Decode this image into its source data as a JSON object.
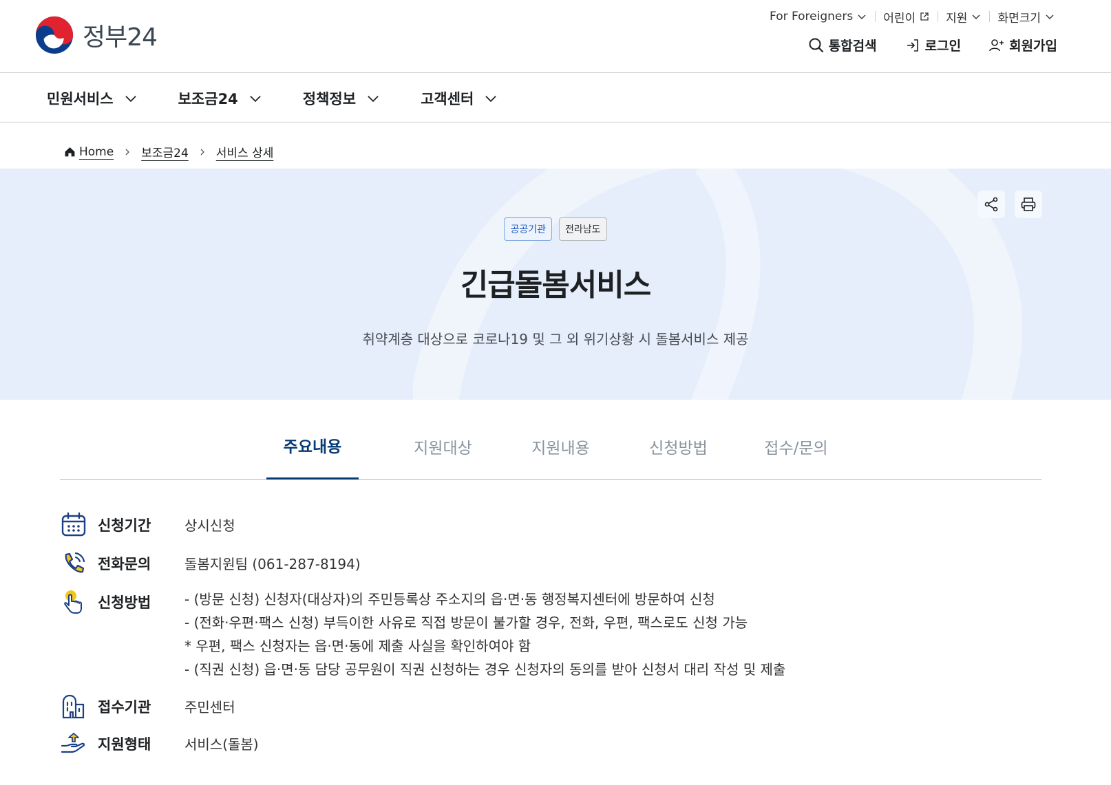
{
  "header": {
    "logo_text": "정부24",
    "util": [
      {
        "label": "For Foreigners",
        "icon": "chevron-down-icon"
      },
      {
        "label": "어린이",
        "icon": "external-link-icon"
      },
      {
        "label": "지원",
        "icon": "chevron-down-icon"
      },
      {
        "label": "화면크기",
        "icon": "chevron-down-icon"
      }
    ],
    "actions": {
      "search": "통합검색",
      "login": "로그인",
      "signup": "회원가입"
    }
  },
  "gnb": {
    "items": [
      "민원서비스",
      "보조금24",
      "정책정보",
      "고객센터"
    ]
  },
  "breadcrumb": [
    "Home",
    "보조금24",
    "서비스 상세"
  ],
  "hero": {
    "tags": [
      "공공기관",
      "전라남도"
    ],
    "title": "긴급돌봄서비스",
    "description": "취약계층 대상으로 코로나19 및 그 외 위기상황 시 돌봄서비스 제공"
  },
  "tabs": [
    "주요내용",
    "지원대상",
    "지원내용",
    "신청방법",
    "접수/문의"
  ],
  "active_tab": "주요내용",
  "details": {
    "period": {
      "label": "신청기간",
      "value": "상시신청"
    },
    "phone": {
      "label": "전화문의",
      "value": "돌봄지원팀 (061-287-8194)"
    },
    "method": {
      "label": "신청방법",
      "lines": [
        "- (방문 신청) 신청자(대상자)의 주민등록상 주소지의 읍·면·동 행정복지센터에 방문하여 신청",
        "- (전화·우편·팩스 신청) 부득이한 사유로 직접 방문이 불가할 경우, 전화, 우편, 팩스로도 신청 가능",
        "* 우편, 팩스 신청자는 읍·면·동에 제출 사실을 확인하여야 함",
        "- (직권 신청) 읍·면·동 담당 공무원이 직권 신청하는 경우 신청자의 동의를 받아 신청서 대리 작성 및 제출"
      ]
    },
    "agency": {
      "label": "접수기관",
      "value": "주민센터"
    },
    "support_type": {
      "label": "지원형태",
      "value": "서비스(돌봄)"
    }
  },
  "colors": {
    "hero_bg": "#e6eefb",
    "active_tab": "#063a74",
    "icon_blue": "#1d3f86",
    "icon_yellow": "#f5c518"
  }
}
